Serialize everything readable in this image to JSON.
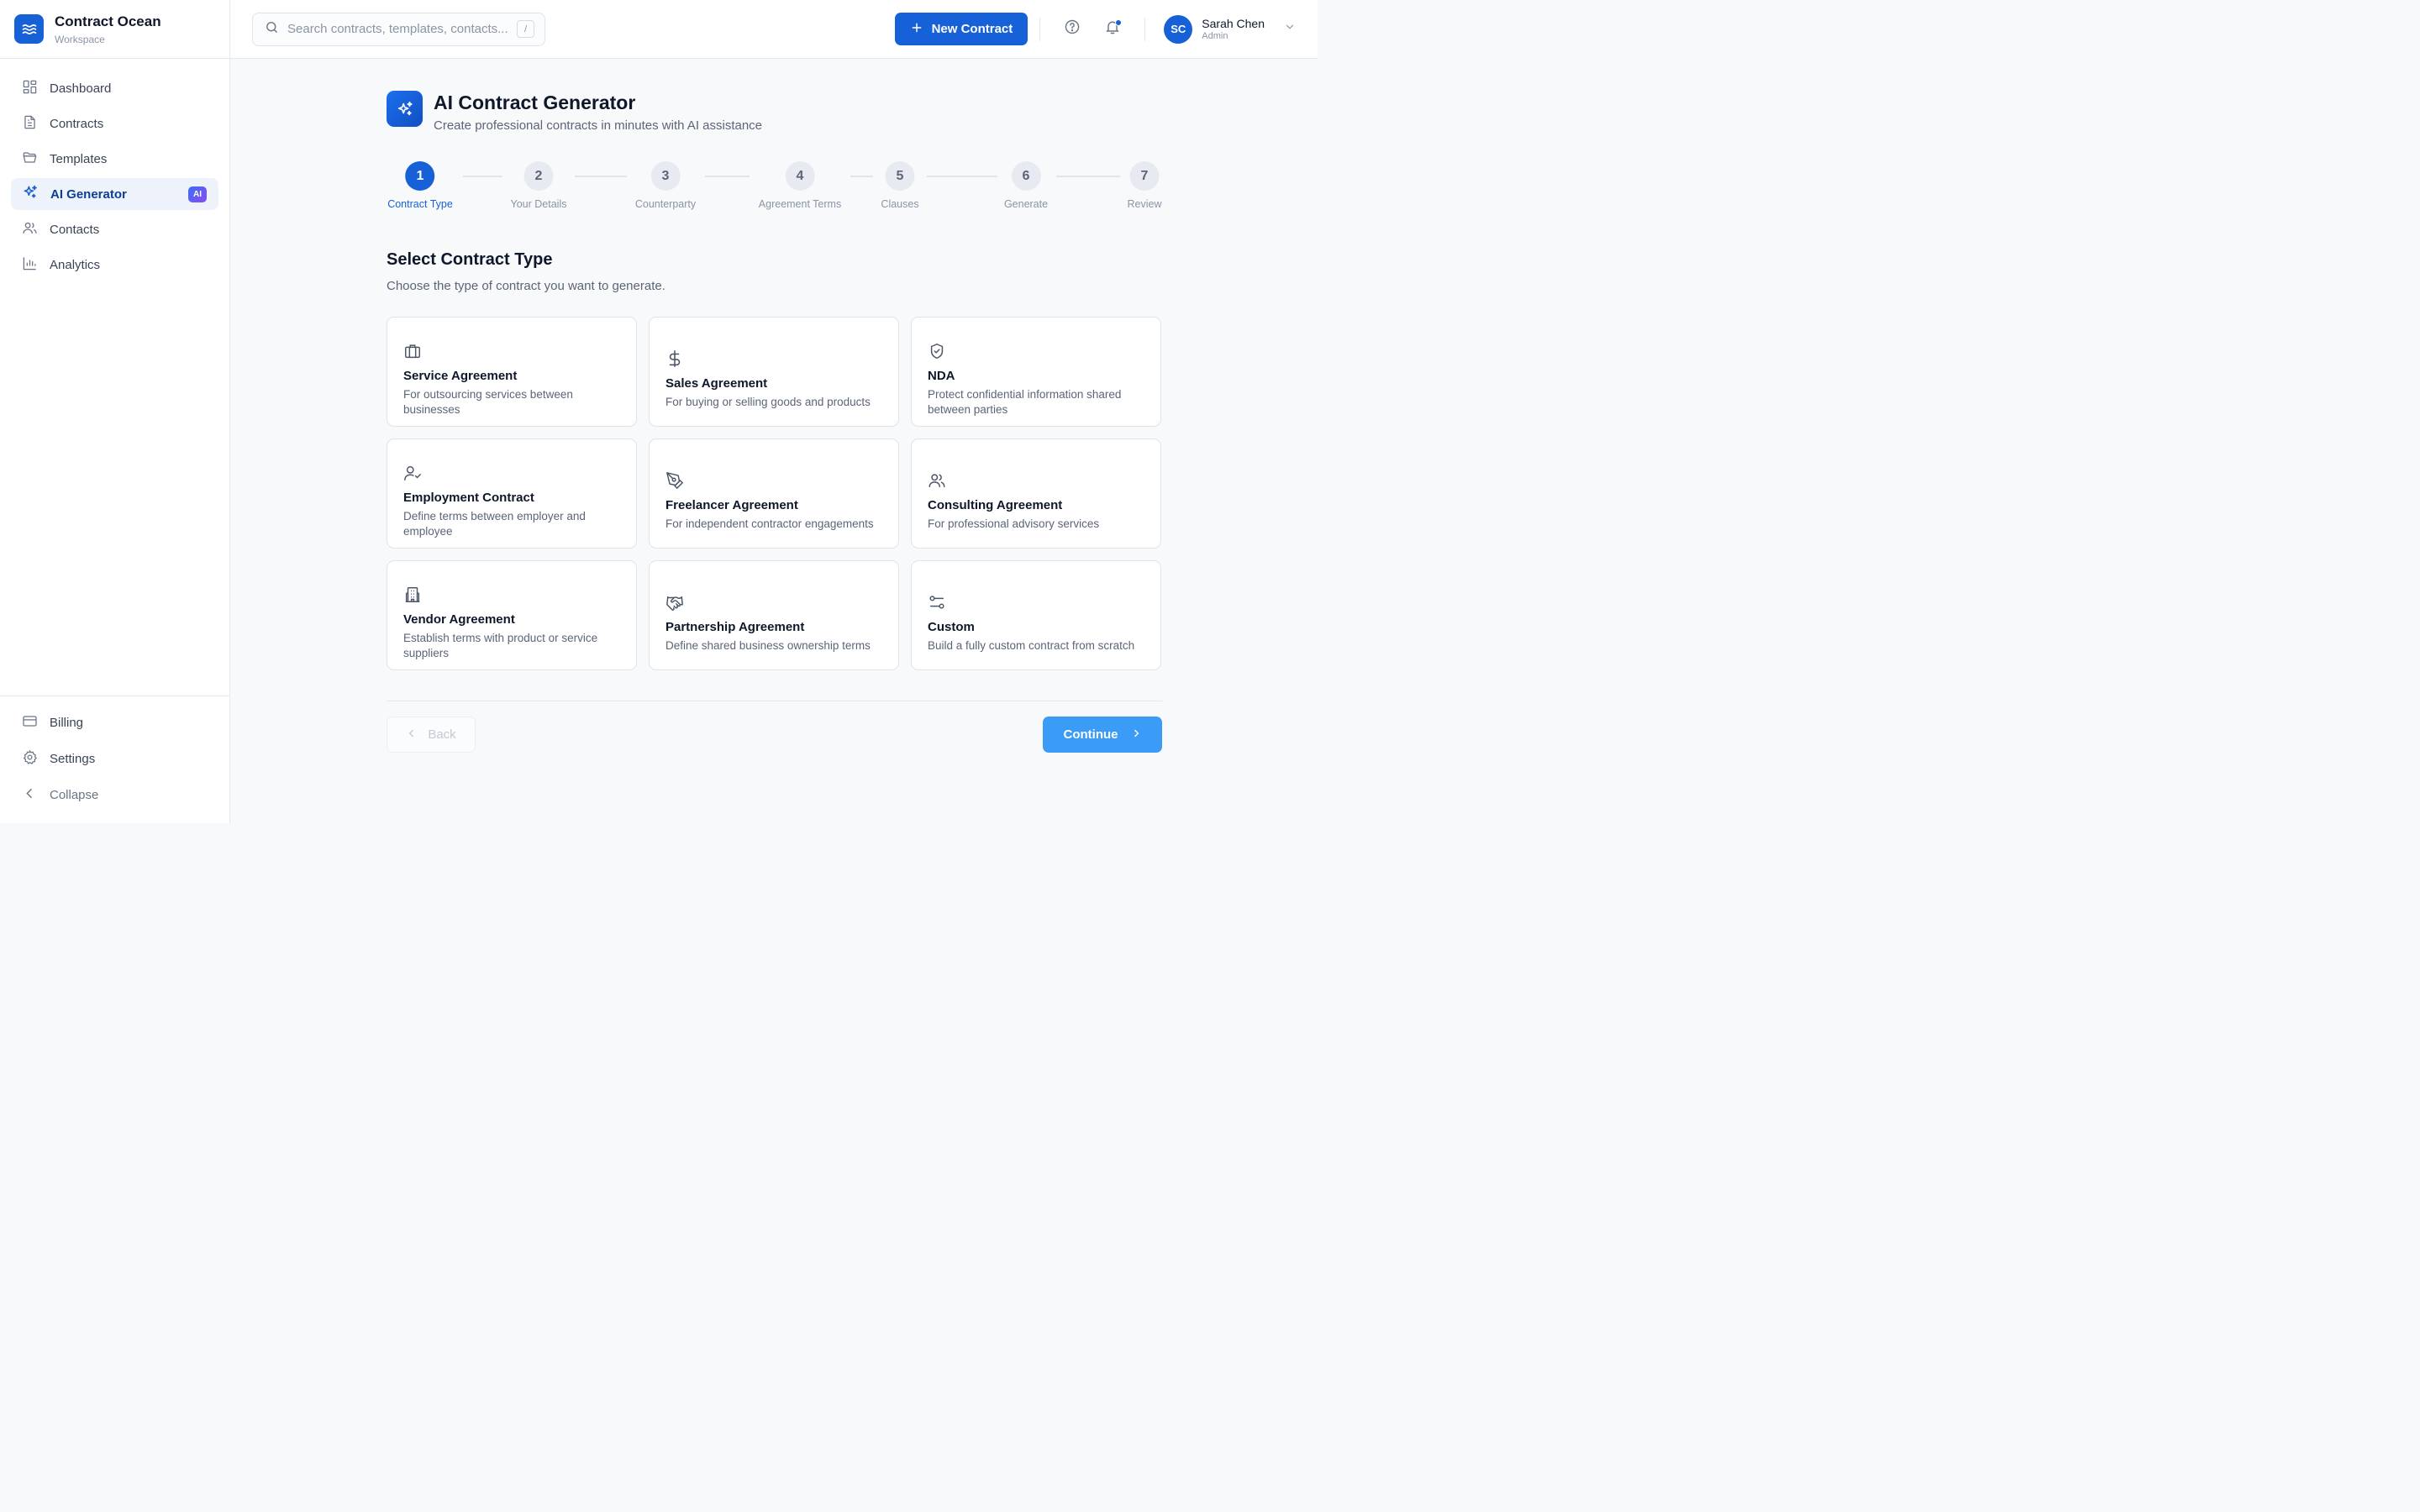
{
  "brand": {
    "name": "Contract Ocean",
    "subtitle": "Workspace"
  },
  "nav": {
    "items": [
      {
        "label": "Dashboard",
        "icon": "dashboard-icon"
      },
      {
        "label": "Contracts",
        "icon": "document-icon"
      },
      {
        "label": "Templates",
        "icon": "folder-icon"
      },
      {
        "label": "AI Generator",
        "icon": "sparkles-icon",
        "badge": "AI",
        "active": true
      },
      {
        "label": "Contacts",
        "icon": "users-icon"
      },
      {
        "label": "Analytics",
        "icon": "bar-chart-icon"
      }
    ],
    "bottom": [
      {
        "label": "Billing",
        "icon": "credit-card-icon"
      },
      {
        "label": "Settings",
        "icon": "gear-icon"
      },
      {
        "label": "Collapse",
        "icon": "chevron-left-icon"
      }
    ]
  },
  "topbar": {
    "search_placeholder": "Search contracts, templates, contacts...",
    "search_shortcut": "/",
    "new_contract_label": "New Contract",
    "user": {
      "initials": "SC",
      "name": "Sarah Chen",
      "role": "Admin"
    }
  },
  "generator": {
    "title": "AI Contract Generator",
    "subtitle": "Create professional contracts in minutes with AI assistance"
  },
  "steps": [
    {
      "number": "1",
      "label": "Contract Type",
      "active": true
    },
    {
      "number": "2",
      "label": "Your Details"
    },
    {
      "number": "3",
      "label": "Counterparty"
    },
    {
      "number": "4",
      "label": "Agreement Terms"
    },
    {
      "number": "5",
      "label": "Clauses"
    },
    {
      "number": "6",
      "label": "Generate"
    },
    {
      "number": "7",
      "label": "Review"
    }
  ],
  "section": {
    "title": "Select Contract Type",
    "subtitle": "Choose the type of contract you want to generate."
  },
  "contract_types": [
    {
      "title": "Service Agreement",
      "description": "For outsourcing services between businesses",
      "icon": "briefcase-icon"
    },
    {
      "title": "Sales Agreement",
      "description": "For buying or selling goods and products",
      "icon": "dollar-icon"
    },
    {
      "title": "NDA",
      "description": "Protect confidential information shared between parties",
      "icon": "shield-check-icon"
    },
    {
      "title": "Employment Contract",
      "description": "Define terms between employer and employee",
      "icon": "user-check-icon"
    },
    {
      "title": "Freelancer Agreement",
      "description": "For independent contractor engagements",
      "icon": "pen-tool-icon"
    },
    {
      "title": "Consulting Agreement",
      "description": "For professional advisory services",
      "icon": "users-icon"
    },
    {
      "title": "Vendor Agreement",
      "description": "Establish terms with product or service suppliers",
      "icon": "building-icon"
    },
    {
      "title": "Partnership Agreement",
      "description": "Define shared business ownership terms",
      "icon": "handshake-icon"
    },
    {
      "title": "Custom",
      "description": "Build a fully custom contract from scratch",
      "icon": "sliders-icon"
    }
  ],
  "actions": {
    "back_label": "Back",
    "continue_label": "Continue"
  },
  "colors": {
    "primary": "#1761d8",
    "continue": "#3b9cf7",
    "active_nav_bg": "#eef3fb"
  }
}
